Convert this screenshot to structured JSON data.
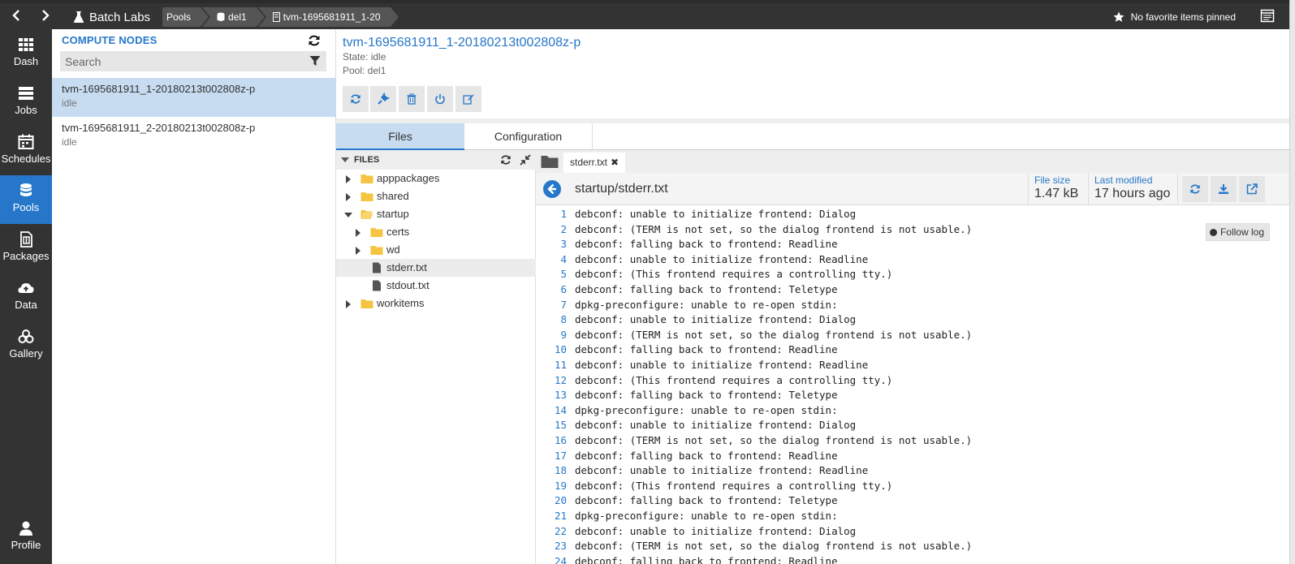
{
  "app": {
    "brand": "Batch Labs"
  },
  "breadcrumb": [
    {
      "label": "Pools",
      "icon": ""
    },
    {
      "label": "del1",
      "icon": "database-icon"
    },
    {
      "label": "tvm-1695681911_1-20",
      "icon": "server-icon"
    }
  ],
  "favorites": {
    "label": "No favorite items pinned"
  },
  "nav": [
    {
      "label": "Dash",
      "icon": "dashboard-icon"
    },
    {
      "label": "Jobs",
      "icon": "jobs-icon"
    },
    {
      "label": "Schedules",
      "icon": "calendar-icon"
    },
    {
      "label": "Pools",
      "icon": "database-icon",
      "active": true
    },
    {
      "label": "Packages",
      "icon": "package-icon"
    },
    {
      "label": "Data",
      "icon": "cloud-upload-icon"
    },
    {
      "label": "Gallery",
      "icon": "gallery-icon"
    },
    {
      "label": "Profile",
      "icon": "user-icon"
    }
  ],
  "nodes_panel": {
    "title": "COMPUTE NODES",
    "search_placeholder": "Search",
    "nodes": [
      {
        "name": "tvm-1695681911_1-20180213t002808z-p",
        "state": "idle",
        "selected": true
      },
      {
        "name": "tvm-1695681911_2-20180213t002808z-p",
        "state": "idle",
        "selected": false
      }
    ]
  },
  "node_details": {
    "title": "tvm-1695681911_1-20180213t002808z-p",
    "state": "State: idle",
    "pool": "Pool: del1",
    "actions": [
      "refresh-icon",
      "plug-icon",
      "trash-icon",
      "power-icon",
      "edit-icon"
    ]
  },
  "tabs": [
    {
      "label": "Files",
      "active": true
    },
    {
      "label": "Configuration",
      "active": false
    }
  ],
  "tree": {
    "header": "FILES",
    "items": [
      {
        "label": "apppackages",
        "type": "folder",
        "depth": 0,
        "expanded": false
      },
      {
        "label": "shared",
        "type": "folder",
        "depth": 0,
        "expanded": false
      },
      {
        "label": "startup",
        "type": "folder",
        "depth": 0,
        "expanded": true
      },
      {
        "label": "certs",
        "type": "folder",
        "depth": 1,
        "expanded": false
      },
      {
        "label": "wd",
        "type": "folder",
        "depth": 1,
        "expanded": false
      },
      {
        "label": "stderr.txt",
        "type": "file",
        "depth": 1,
        "selected": true
      },
      {
        "label": "stdout.txt",
        "type": "file",
        "depth": 1
      },
      {
        "label": "workitems",
        "type": "folder",
        "depth": 0,
        "expanded": false
      }
    ]
  },
  "viewer": {
    "tab": "stderr.txt",
    "path": "startup/stderr.txt",
    "file_size_label": "File size",
    "file_size": "1.47 kB",
    "last_modified_label": "Last modified",
    "last_modified": "17 hours ago",
    "follow_log": "Follow log",
    "lines": [
      "debconf: unable to initialize frontend: Dialog",
      "debconf: (TERM is not set, so the dialog frontend is not usable.)",
      "debconf: falling back to frontend: Readline",
      "debconf: unable to initialize frontend: Readline",
      "debconf: (This frontend requires a controlling tty.)",
      "debconf: falling back to frontend: Teletype",
      "dpkg-preconfigure: unable to re-open stdin:",
      "debconf: unable to initialize frontend: Dialog",
      "debconf: (TERM is not set, so the dialog frontend is not usable.)",
      "debconf: falling back to frontend: Readline",
      "debconf: unable to initialize frontend: Readline",
      "debconf: (This frontend requires a controlling tty.)",
      "debconf: falling back to frontend: Teletype",
      "dpkg-preconfigure: unable to re-open stdin:",
      "debconf: unable to initialize frontend: Dialog",
      "debconf: (TERM is not set, so the dialog frontend is not usable.)",
      "debconf: falling back to frontend: Readline",
      "debconf: unable to initialize frontend: Readline",
      "debconf: (This frontend requires a controlling tty.)",
      "debconf: falling back to frontend: Teletype",
      "dpkg-preconfigure: unable to re-open stdin:",
      "debconf: unable to initialize frontend: Dialog",
      "debconf: (TERM is not set, so the dialog frontend is not usable.)",
      "debconf: falling back to frontend: Readline"
    ]
  },
  "colors": {
    "accent": "#2677c9",
    "topbar": "#333333",
    "selected": "#c7dcf0",
    "folder": "#f5c542"
  }
}
